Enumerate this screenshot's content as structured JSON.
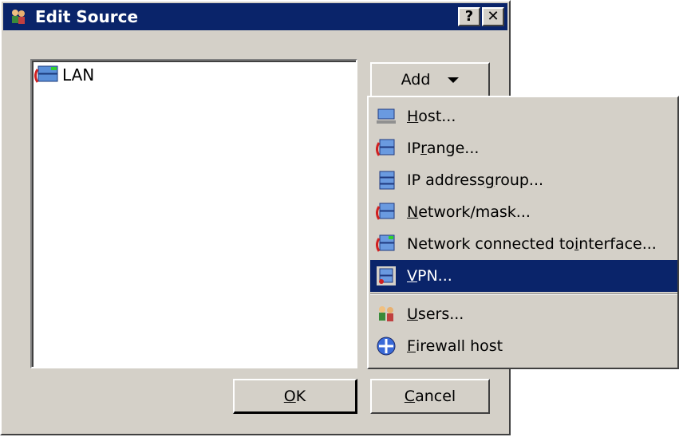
{
  "window": {
    "title": "Edit Source",
    "help_label": "?",
    "close_label": "✕"
  },
  "source_list": {
    "items": [
      {
        "label": "LAN",
        "icon": "network-interface-icon"
      }
    ]
  },
  "buttons": {
    "add": "Add",
    "ok": "OK",
    "ok_mnemonic": "O",
    "ok_rest": "K",
    "cancel_mnemonic": "C",
    "cancel_rest": "ancel"
  },
  "add_menu": {
    "items": [
      {
        "pre": "",
        "mn": "H",
        "post": "ost...",
        "icon": "host-icon",
        "selected": false
      },
      {
        "pre": "IP ",
        "mn": "r",
        "post": "ange...",
        "icon": "ip-range-icon",
        "selected": false
      },
      {
        "pre": "IP address ",
        "mn": "g",
        "post": "roup...",
        "icon": "ip-group-icon",
        "selected": false
      },
      {
        "pre": "",
        "mn": "N",
        "post": "etwork/mask...",
        "icon": "network-mask-icon",
        "selected": false
      },
      {
        "pre": "Network connected to ",
        "mn": "i",
        "post": "nterface...",
        "icon": "network-interface-icon",
        "selected": false
      },
      {
        "pre": "",
        "mn": "V",
        "post": "PN...",
        "icon": "vpn-icon",
        "selected": true
      },
      {
        "pre": "",
        "mn": "U",
        "post": "sers...",
        "icon": "users-icon",
        "selected": false
      },
      {
        "pre": "",
        "mn": "F",
        "post": "irewall host",
        "icon": "firewall-host-icon",
        "selected": false
      }
    ]
  },
  "colors": {
    "titlebar": "#0a246a",
    "face": "#d4d0c8",
    "selection": "#0a246a"
  }
}
